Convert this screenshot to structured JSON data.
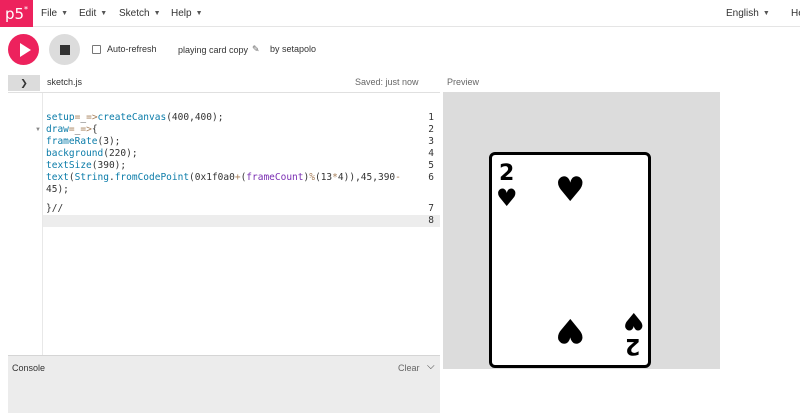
{
  "nav": {
    "logo": "p5",
    "logo_sup": "*",
    "menu": [
      "File",
      "Edit",
      "Sketch",
      "Help"
    ],
    "language": "English",
    "greeting": "Hello"
  },
  "toolbar": {
    "auto_refresh_label": "Auto-refresh",
    "sketch_name": "playing card copy",
    "byline": "by setapolo"
  },
  "filebar": {
    "toggle_glyph": "❯",
    "file_name": "sketch.js",
    "saved_status": "Saved: just now",
    "preview_label": "Preview"
  },
  "editor": {
    "line_numbers": [
      "1",
      "2",
      "3",
      "4",
      "5",
      "6",
      "",
      "7",
      "8"
    ],
    "lines": [
      "setup=_=>createCanvas(400,400);",
      "draw=_=>{",
      "frameRate(3);",
      "background(220);",
      "textSize(390);",
      "text(String.fromCodePoint(0x1f0a0+(frameCount)%(13*4)),45,390-",
      "45);",
      "}//",
      ""
    ]
  },
  "console": {
    "label": "Console",
    "clear_label": "Clear"
  },
  "preview": {
    "card_rank": "2",
    "card_suit": "♥"
  },
  "colors": {
    "accent": "#ed225d",
    "canvas_bg": "#dcdcdc"
  }
}
